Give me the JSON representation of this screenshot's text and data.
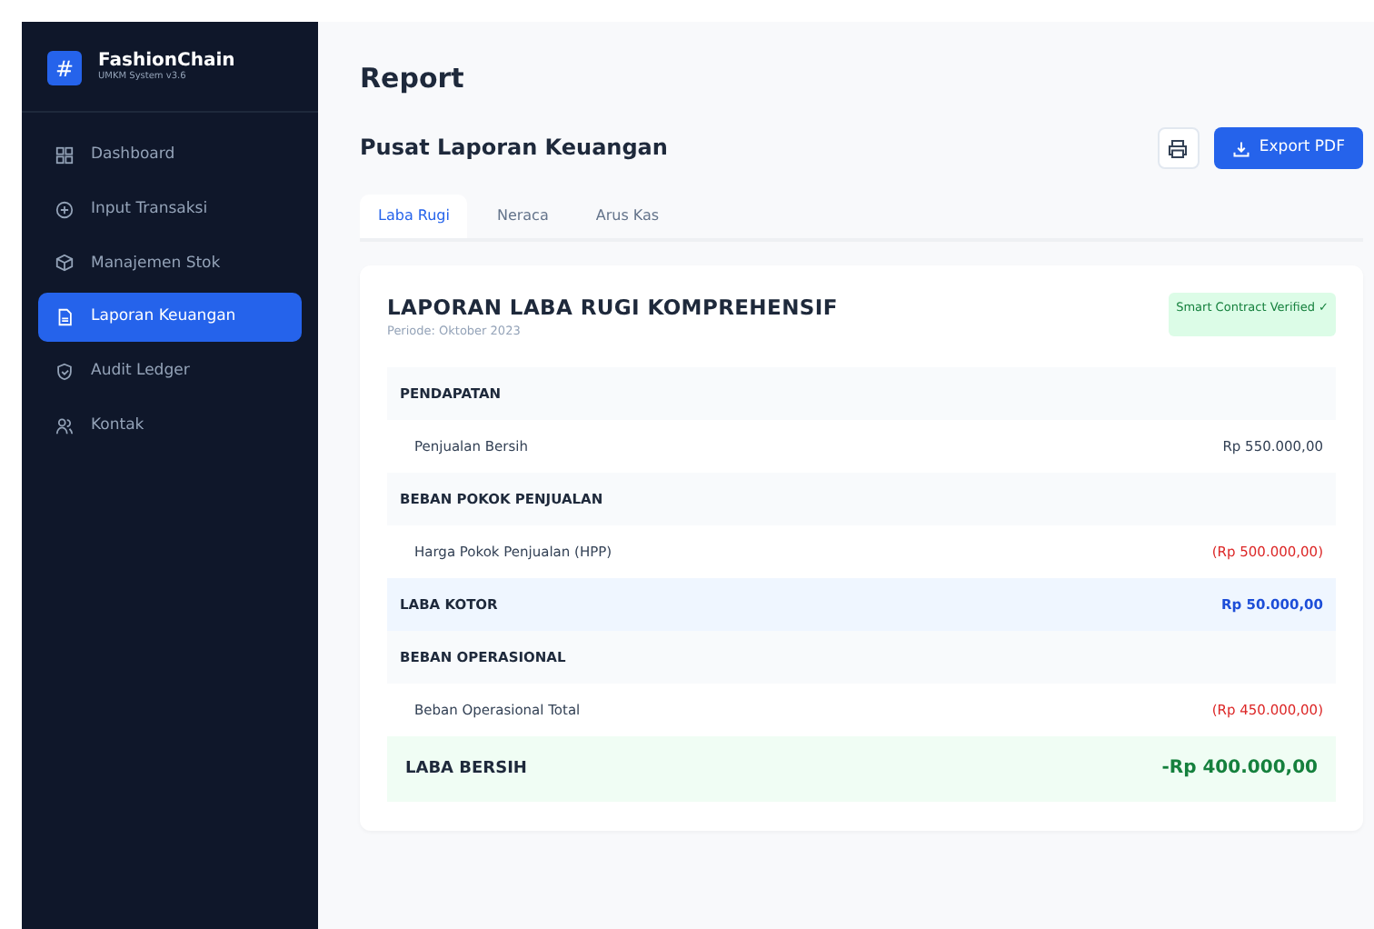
{
  "brand": {
    "logo": "#",
    "name": "FashionChain",
    "version": "UMKM System v3.6"
  },
  "sidebar": {
    "items": [
      {
        "label": "Dashboard",
        "selected": false
      },
      {
        "label": "Input Transaksi",
        "selected": false
      },
      {
        "label": "Manajemen Stok",
        "selected": false
      },
      {
        "label": "Laporan Keuangan",
        "selected": true
      },
      {
        "label": "Audit Ledger",
        "selected": false
      },
      {
        "label": "Kontak",
        "selected": false
      }
    ]
  },
  "page_title": "Report",
  "section_title": "Pusat Laporan Keuangan",
  "export_button": "Export PDF",
  "tabs": [
    {
      "label": "Laba Rugi",
      "selected": true
    },
    {
      "label": "Neraca",
      "selected": false
    },
    {
      "label": "Arus Kas",
      "selected": false
    }
  ],
  "report": {
    "title": "LAPORAN LABA RUGI KOMPREHENSIF",
    "period": "Periode: Oktober 2023",
    "badge": "Smart Contract Verified ✓",
    "rows": [
      {
        "kind": "section",
        "label": "PENDAPATAN"
      },
      {
        "kind": "item",
        "label": "Penjualan Bersih",
        "amount": "Rp 550.000,00",
        "negative": false
      },
      {
        "kind": "section",
        "label": "BEBAN POKOK PENJUALAN"
      },
      {
        "kind": "item",
        "label": "Harga Pokok Penjualan (HPP)",
        "amount": "(Rp 500.000,00)",
        "negative": true
      },
      {
        "kind": "subtotal",
        "label": "LABA KOTOR",
        "amount": "Rp 50.000,00"
      },
      {
        "kind": "section",
        "label": "BEBAN OPERASIONAL"
      },
      {
        "kind": "item",
        "label": "Beban Operasional Total",
        "amount": "(Rp 450.000,00)",
        "negative": true
      },
      {
        "kind": "total",
        "label": "LABA BERSIH",
        "amount": "-Rp 400.000,00"
      }
    ]
  }
}
